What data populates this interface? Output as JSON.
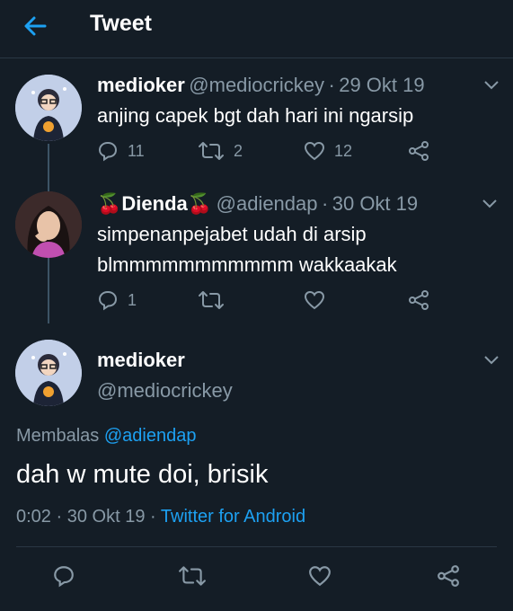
{
  "header": {
    "title": "Tweet"
  },
  "thread": [
    {
      "name": "medioker",
      "handle": "@mediocrickey",
      "separator": "·",
      "date": "29 Okt 19",
      "text_lines": [
        "anjing capek bgt dah hari ini ngarsip"
      ],
      "reply_count": "11",
      "retweet_count": "2",
      "like_count": "12"
    },
    {
      "name_prefix": "🍒",
      "name": "Dienda",
      "name_suffix": "🍒",
      "handle": "@adiendap",
      "separator": "·",
      "date": "30 Okt 19",
      "text_lines": [
        "simpenanpejabet udah di arsip",
        "blmmmmmmmmmmm wakkaakak"
      ],
      "reply_count": "1",
      "retweet_count": "",
      "like_count": ""
    }
  ],
  "main_tweet": {
    "name": "medioker",
    "handle": "@mediocrickey",
    "reply_label": "Membalas",
    "reply_mention": "@adiendap",
    "text": "dah w mute doi, brisik",
    "time": "0:02",
    "separator": "·",
    "date": "30 Okt 19",
    "separator2": "·",
    "client": "Twitter for Android"
  },
  "colors": {
    "background": "#141d26",
    "accent": "#1da1f2",
    "muted": "#8899a6",
    "divider": "#2a3744"
  },
  "icons": [
    "back-arrow-icon",
    "chevron-down-icon",
    "reply-icon",
    "retweet-icon",
    "like-icon",
    "share-icon"
  ]
}
